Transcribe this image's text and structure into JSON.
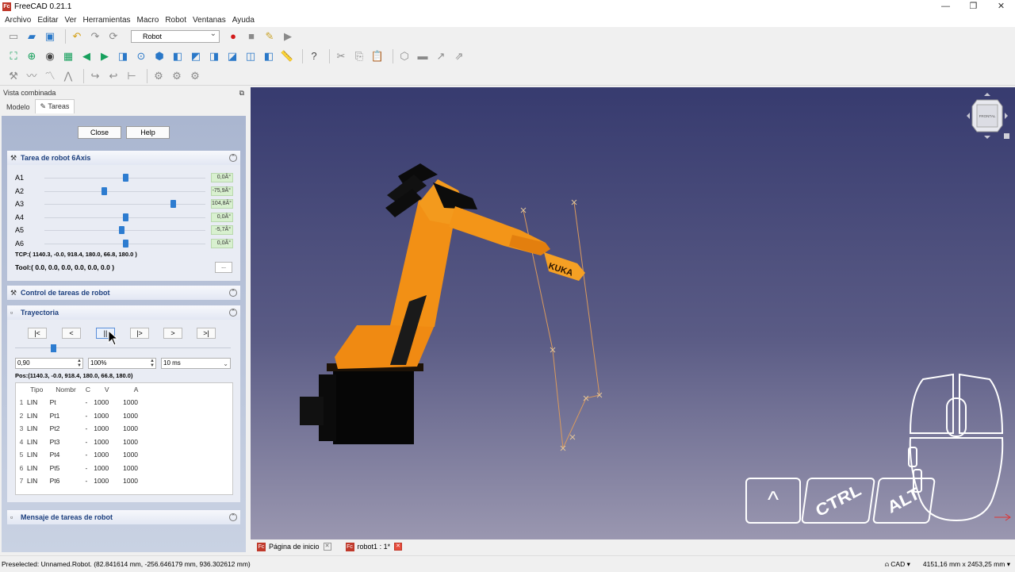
{
  "window": {
    "title": "FreeCAD 0.21.1",
    "app_icon": "Fc",
    "controls": [
      "—",
      "❐",
      "✕"
    ]
  },
  "menu": [
    "Archivo",
    "Editar",
    "Ver",
    "Herramientas",
    "Macro",
    "Robot",
    "Ventanas",
    "Ayuda"
  ],
  "toolbar": {
    "workbench": "Robot"
  },
  "combo": {
    "title": "Vista combinada",
    "tabs": [
      "Modelo",
      "Tareas"
    ],
    "close_label": "Close",
    "help_label": "Help",
    "axis_panel": {
      "title": "Tarea de robot 6Axis",
      "axes": [
        {
          "label": "A1",
          "value": "0,0Â°",
          "pos": 0.5
        },
        {
          "label": "A2",
          "value": "-75,9Â°",
          "pos": 0.37
        },
        {
          "label": "A3",
          "value": "104,8Â°",
          "pos": 0.8
        },
        {
          "label": "A4",
          "value": "0,0Â°",
          "pos": 0.5
        },
        {
          "label": "A5",
          "value": "-5,7Â°",
          "pos": 0.48
        },
        {
          "label": "A6",
          "value": "0,0Â°",
          "pos": 0.5
        }
      ],
      "tcp": "TCP:( 1140.3,  -0.0, 918.4, 180.0, 66.8, 180.0 )",
      "tool": "Tool:( 0.0, 0.0, 0.0, 0.0, 0.0, 0.0 )",
      "tool_button": "..."
    },
    "control_panel": {
      "title": "Control de tareas de robot"
    },
    "traj_panel": {
      "title": "Trayectoria",
      "buttons": [
        "|<",
        "<",
        "||",
        "|>",
        ">",
        ">|"
      ],
      "progress": 0.05,
      "speed": "0,90",
      "percent": "100%",
      "interval": "10 ms",
      "pos": "Pos:(1140.3,  -0.0, 918.4, 180.0, 66.8, 180.0)",
      "columns": [
        "Tipo",
        "Nombr",
        "C",
        "V",
        "A"
      ],
      "rows": [
        {
          "n": "1",
          "tipo": "LIN",
          "nombre": "Pt",
          "c": "-",
          "v": "1000",
          "a": "1000"
        },
        {
          "n": "2",
          "tipo": "LIN",
          "nombre": "Pt1",
          "c": "-",
          "v": "1000",
          "a": "1000"
        },
        {
          "n": "3",
          "tipo": "LIN",
          "nombre": "Pt2",
          "c": "-",
          "v": "1000",
          "a": "1000"
        },
        {
          "n": "4",
          "tipo": "LIN",
          "nombre": "Pt3",
          "c": "-",
          "v": "1000",
          "a": "1000"
        },
        {
          "n": "5",
          "tipo": "LIN",
          "nombre": "Pt4",
          "c": "-",
          "v": "1000",
          "a": "1000"
        },
        {
          "n": "6",
          "tipo": "LIN",
          "nombre": "Pt5",
          "c": "-",
          "v": "1000",
          "a": "1000"
        },
        {
          "n": "7",
          "tipo": "LIN",
          "nombre": "Pt6",
          "c": "-",
          "v": "1000",
          "a": "1000"
        }
      ]
    },
    "message_panel": {
      "title": "Mensaje de tareas de robot"
    }
  },
  "viewport": {
    "cube_label": "FRONTAL",
    "robot_brand": "KUKA",
    "keys": [
      "^",
      "CTRL",
      "ALT"
    ]
  },
  "doc_tabs": [
    {
      "label": "Página de inicio"
    },
    {
      "label": "robot1 : 1*"
    }
  ],
  "status": {
    "preselected": "Preselected: Unnamed.Robot. (82.841614 mm, -256.646179 mm, 936.302612 mm)",
    "nav_style": "CAD",
    "dimensions": "4151,16 mm x 2453,25 mm"
  },
  "colors": {
    "accent": "#2d7cd0",
    "robot": "#f08a12",
    "bg_top": "#373b6f",
    "bg_bottom": "#9a97b0"
  }
}
